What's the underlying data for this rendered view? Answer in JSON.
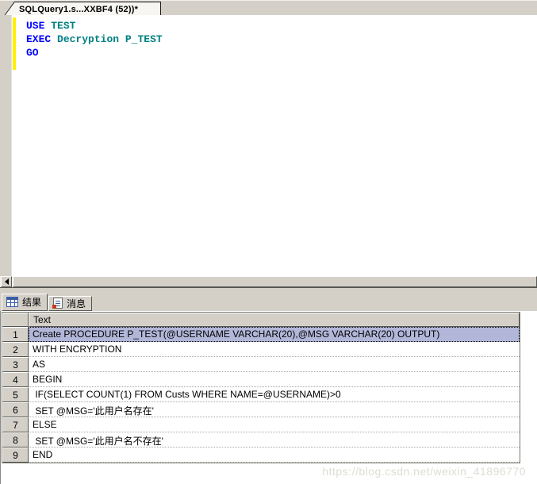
{
  "colors": {
    "chrome": "#d4d0c8",
    "keyword": "#0000ff",
    "identifier": "#008080",
    "selection_row": "#b2b7d9",
    "change_bar": "#ffef00"
  },
  "document_tab": {
    "title": "SQLQuery1.s...XXBF4 (52))*"
  },
  "editor": {
    "lines": [
      [
        {
          "t": "USE",
          "c": "kw"
        },
        {
          "t": " ",
          "c": "id"
        },
        {
          "t": "TEST",
          "c": "id"
        }
      ],
      [
        {
          "t": "EXEC",
          "c": "kw"
        },
        {
          "t": " ",
          "c": "id"
        },
        {
          "t": "Decryption P_TEST",
          "c": "id"
        }
      ],
      [
        {
          "t": "GO",
          "c": "kw"
        }
      ]
    ]
  },
  "results": {
    "tabs": [
      {
        "label": "结果",
        "icon": "grid-icon",
        "active": true
      },
      {
        "label": "消息",
        "icon": "message-icon",
        "active": false
      }
    ],
    "grid": {
      "corner_label": "",
      "columns": [
        "Text"
      ],
      "rows": [
        {
          "num": "1",
          "text": "Create PROCEDURE P_TEST(@USERNAME VARCHAR(20),@MSG VARCHAR(20) OUTPUT)",
          "selected": true
        },
        {
          "num": "2",
          "text": "WITH ENCRYPTION",
          "selected": false
        },
        {
          "num": "3",
          "text": "AS",
          "selected": false
        },
        {
          "num": "4",
          "text": "BEGIN",
          "selected": false
        },
        {
          "num": "5",
          "text": " IF(SELECT COUNT(1) FROM Custs WHERE NAME=@USERNAME)>0",
          "selected": false
        },
        {
          "num": "6",
          "text": " SET @MSG='此用户名存在'",
          "selected": false
        },
        {
          "num": "7",
          "text": "ELSE",
          "selected": false
        },
        {
          "num": "8",
          "text": " SET @MSG='此用户名不存在'",
          "selected": false
        },
        {
          "num": "9",
          "text": "END",
          "selected": false
        }
      ]
    }
  },
  "watermark": "https://blog.csdn.net/weixin_41896770"
}
